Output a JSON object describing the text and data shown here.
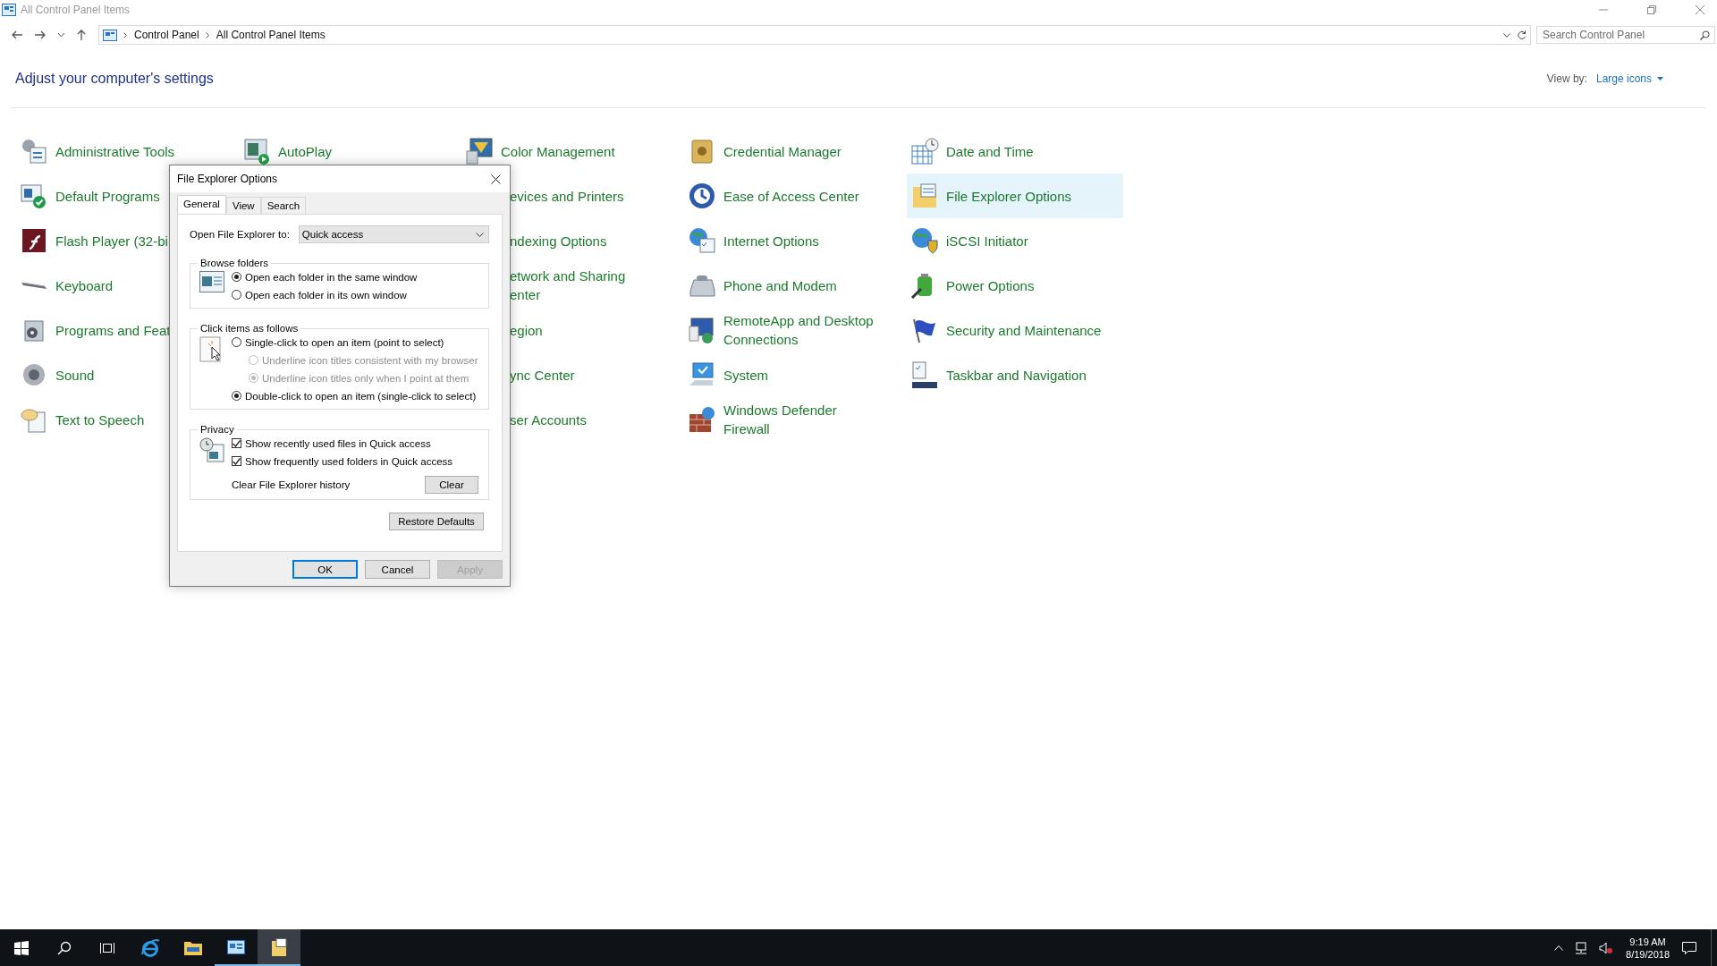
{
  "window": {
    "title": "All Control Panel Items"
  },
  "address_bar": {
    "path": [
      "Control Panel",
      "All Control Panel Items"
    ]
  },
  "search": {
    "placeholder": "Search Control Panel"
  },
  "heading": "Adjust your computer's settings",
  "view_by": {
    "label": "View by:",
    "value": "Large icons"
  },
  "item_columns": [
    [
      {
        "label": "Administrative Tools",
        "selected": false,
        "covered": false
      },
      {
        "label": "Default Programs",
        "selected": false,
        "covered": false
      },
      {
        "label": "Flash Player (32-bi",
        "selected": false,
        "covered": false
      },
      {
        "label": "Keyboard",
        "selected": false,
        "covered": false
      },
      {
        "label": "Programs and Feat",
        "selected": false,
        "covered": false
      },
      {
        "label": "Sound",
        "selected": false,
        "covered": false
      },
      {
        "label": "Text to Speech",
        "selected": false,
        "covered": false
      }
    ],
    [
      {
        "label": "AutoPlay",
        "selected": false,
        "covered": false
      }
    ],
    [
      {
        "label": "Color Management",
        "selected": false,
        "covered": false
      },
      {
        "label": "evices and Printers",
        "selected": false,
        "covered": true
      },
      {
        "label": "ndexing Options",
        "selected": false,
        "covered": true
      },
      {
        "label": "etwork and Sharing enter",
        "selected": false,
        "covered": true
      },
      {
        "label": "egion",
        "selected": false,
        "covered": true
      },
      {
        "label": "ync Center",
        "selected": false,
        "covered": true
      },
      {
        "label": "ser Accounts",
        "selected": false,
        "covered": true
      }
    ],
    [
      {
        "label": "Credential Manager",
        "selected": false,
        "covered": false
      },
      {
        "label": "Ease of Access Center",
        "selected": false,
        "covered": false
      },
      {
        "label": "Internet Options",
        "selected": false,
        "covered": false
      },
      {
        "label": "Phone and Modem",
        "selected": false,
        "covered": false
      },
      {
        "label": "RemoteApp and Desktop Connections",
        "selected": false,
        "covered": false
      },
      {
        "label": "System",
        "selected": false,
        "covered": false
      },
      {
        "label": "Windows Defender Firewall",
        "selected": false,
        "covered": false
      }
    ],
    [
      {
        "label": "Date and Time",
        "selected": false,
        "covered": false
      },
      {
        "label": "File Explorer Options",
        "selected": true,
        "covered": false
      },
      {
        "label": "iSCSI Initiator",
        "selected": false,
        "covered": false
      },
      {
        "label": "Power Options",
        "selected": false,
        "covered": false
      },
      {
        "label": "Security and Maintenance",
        "selected": false,
        "covered": false
      },
      {
        "label": "Taskbar and Navigation",
        "selected": false,
        "covered": false
      }
    ]
  ],
  "dialog": {
    "title": "File Explorer Options",
    "tabs": [
      {
        "label": "General",
        "selected": true
      },
      {
        "label": "View",
        "selected": false
      },
      {
        "label": "Search",
        "selected": false
      }
    ],
    "open_to": {
      "label": "Open File Explorer to:",
      "value": "Quick access"
    },
    "browse": {
      "title": "Browse folders",
      "options": [
        {
          "label": "Open each folder in the same window",
          "selected": true,
          "disabled": false
        },
        {
          "label": "Open each folder in its own window",
          "selected": false,
          "disabled": false
        }
      ]
    },
    "click": {
      "title": "Click items as follows",
      "options": [
        {
          "label": "Single-click to open an item (point to select)",
          "selected": false,
          "disabled": false,
          "kind": "main"
        },
        {
          "label": "Underline icon titles consistent with my browser",
          "selected": false,
          "disabled": true,
          "kind": "sub"
        },
        {
          "label": "Underline icon titles only when I point at them",
          "selected": true,
          "disabled": true,
          "kind": "sub"
        },
        {
          "label": "Double-click to open an item (single-click to select)",
          "selected": true,
          "disabled": false,
          "kind": "main"
        }
      ]
    },
    "privacy": {
      "title": "Privacy",
      "checks": [
        {
          "label": "Show recently used files in Quick access",
          "checked": true
        },
        {
          "label": "Show frequently used folders in Quick access",
          "checked": true
        }
      ],
      "clear_label": "Clear File Explorer history",
      "clear_button": "Clear"
    },
    "restore_button": "Restore Defaults",
    "buttons": [
      {
        "label": "OK",
        "default": true,
        "disabled": false
      },
      {
        "label": "Cancel",
        "default": false,
        "disabled": false
      },
      {
        "label": "Apply",
        "default": false,
        "disabled": true
      }
    ]
  },
  "taskbar": {
    "apps": [
      {
        "running": false,
        "selected": false
      },
      {
        "running": false,
        "selected": false
      },
      {
        "running": true,
        "selected": false
      },
      {
        "running": true,
        "selected": true
      }
    ],
    "time": "9:19 AM",
    "date": "8/19/2018"
  }
}
